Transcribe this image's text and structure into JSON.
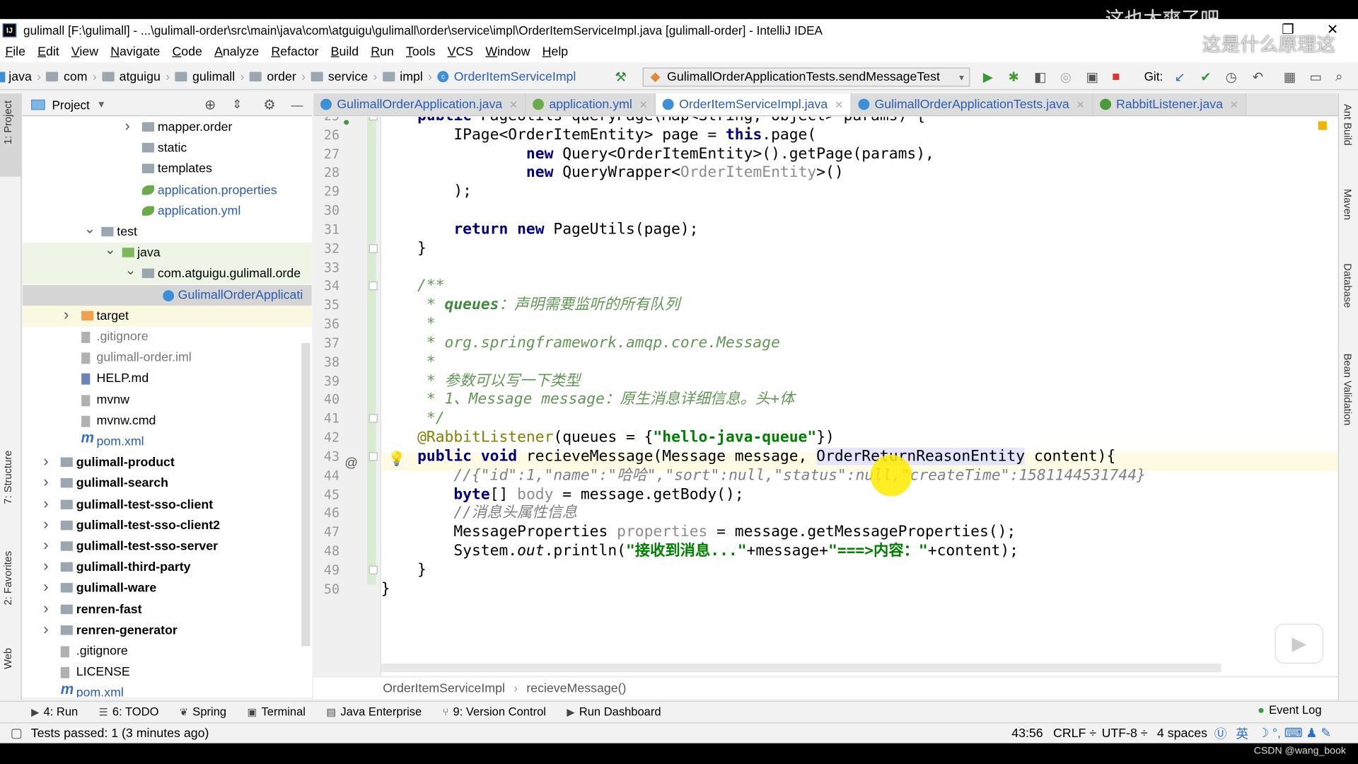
{
  "window": {
    "title": "gulimall [F:\\gulimall] - ...\\gulimall-order\\src\\main\\java\\com\\atguigu\\gulimall\\order\\service\\impl\\OrderItemServiceImpl.java [gulimall-order] - IntelliJ IDEA",
    "logo": "IJ"
  },
  "watermark": {
    "line1": "这也太爽了吧",
    "line2": "这是什么原理这"
  },
  "menu": [
    "File",
    "Edit",
    "View",
    "Navigate",
    "Code",
    "Analyze",
    "Refactor",
    "Build",
    "Run",
    "Tools",
    "VCS",
    "Window",
    "Help"
  ],
  "navbar": {
    "crumbs": [
      "java",
      "com",
      "atguigu",
      "gulimall",
      "order",
      "service",
      "impl"
    ],
    "class_crumb": "OrderItemServiceImpl",
    "run_config": "GulimallOrderApplicationTests.sendMessageTest",
    "git_label": "Git:"
  },
  "left_strip": [
    "1: Project",
    "7: Structure",
    "2: Favorites",
    "Web"
  ],
  "right_strip": [
    "Ant Build",
    "Maven",
    "Database",
    "Bean Validation"
  ],
  "project": {
    "title": "Project",
    "tree": [
      {
        "label": "mapper.order",
        "level": 5,
        "chevron": ">",
        "kind": "folder"
      },
      {
        "label": "static",
        "level": 5,
        "kind": "folder"
      },
      {
        "label": "templates",
        "level": 5,
        "kind": "folder"
      },
      {
        "label": "application.properties",
        "level": 5,
        "kind": "spring",
        "color": "#2a5db0"
      },
      {
        "label": "application.yml",
        "level": 5,
        "kind": "spring",
        "color": "#2a5db0"
      },
      {
        "label": "test",
        "level": 3,
        "chevron": "v",
        "kind": "folder"
      },
      {
        "label": "java",
        "level": 4,
        "chevron": "v",
        "kind": "greenfolder",
        "bg": "#eef5e6"
      },
      {
        "label": "com.atguigu.gulimall.orde",
        "level": 5,
        "chevron": "v",
        "kind": "folder",
        "bg": "#eef5e6"
      },
      {
        "label": "GulimallOrderApplicati",
        "level": 6,
        "kind": "class",
        "color": "#2a5db0",
        "bg": "#d5d5d5"
      },
      {
        "label": "target",
        "level": 2,
        "chevron": ">",
        "kind": "orangefolder",
        "bg": "#fbf8e0"
      },
      {
        "label": ".gitignore",
        "level": 2,
        "kind": "file",
        "color": "#777"
      },
      {
        "label": "gulimall-order.iml",
        "level": 2,
        "kind": "file",
        "color": "#777"
      },
      {
        "label": "HELP.md",
        "level": 2,
        "kind": "md"
      },
      {
        "label": "mvnw",
        "level": 2,
        "kind": "file"
      },
      {
        "label": "mvnw.cmd",
        "level": 2,
        "kind": "file"
      },
      {
        "label": "pom.xml",
        "level": 2,
        "kind": "maven",
        "color": "#2a5db0"
      },
      {
        "label": "gulimall-product",
        "level": 1,
        "chevron": ">",
        "kind": "module",
        "bold": true
      },
      {
        "label": "gulimall-search",
        "level": 1,
        "chevron": ">",
        "kind": "module",
        "bold": true
      },
      {
        "label": "gulimall-test-sso-client",
        "level": 1,
        "chevron": ">",
        "kind": "module",
        "bold": true
      },
      {
        "label": "gulimall-test-sso-client2",
        "level": 1,
        "chevron": ">",
        "kind": "module",
        "bold": true
      },
      {
        "label": "gulimall-test-sso-server",
        "level": 1,
        "chevron": ">",
        "kind": "module",
        "bold": true
      },
      {
        "label": "gulimall-third-party",
        "level": 1,
        "chevron": ">",
        "kind": "module",
        "bold": true
      },
      {
        "label": "gulimall-ware",
        "level": 1,
        "chevron": ">",
        "kind": "module",
        "bold": true
      },
      {
        "label": "renren-fast",
        "level": 1,
        "chevron": ">",
        "kind": "module",
        "bold": true
      },
      {
        "label": "renren-generator",
        "level": 1,
        "chevron": ">",
        "kind": "module",
        "bold": true
      },
      {
        "label": ".gitignore",
        "level": 1,
        "kind": "file"
      },
      {
        "label": "LICENSE",
        "level": 1,
        "kind": "file"
      },
      {
        "label": "pom.xml",
        "level": 1,
        "kind": "maven",
        "color": "#2a5db0"
      }
    ]
  },
  "tabs": [
    {
      "label": "GulimallOrderApplication.java",
      "icon": "class"
    },
    {
      "label": "application.yml",
      "icon": "spring"
    },
    {
      "label": "OrderItemServiceImpl.java",
      "icon": "class",
      "active": true
    },
    {
      "label": "GulimallOrderApplicationTests.java",
      "icon": "class"
    },
    {
      "label": "RabbitListener.java",
      "icon": "annotation"
    }
  ],
  "editor": {
    "first_line": 25,
    "current_line": 43,
    "lines": [
      [
        [
          "    "
        ],
        [
          "public ",
          "kw"
        ],
        [
          "PageUtils queryPage(Map<String, Object> params) {"
        ]
      ],
      [
        [
          "        IPage<OrderItemEntity> page = "
        ],
        [
          "this",
          "kw"
        ],
        [
          ".page("
        ]
      ],
      [
        [
          "                "
        ],
        [
          "new ",
          "kw"
        ],
        [
          "Query<OrderItemEntity>().getPage(params),"
        ]
      ],
      [
        [
          "                "
        ],
        [
          "new ",
          "kw"
        ],
        [
          "QueryWrapper<"
        ],
        [
          "OrderItemEntity",
          "gray"
        ],
        [
          ">()"
        ]
      ],
      [
        [
          "        );"
        ]
      ],
      [
        [
          ""
        ]
      ],
      [
        [
          "        "
        ],
        [
          "return new ",
          "kw"
        ],
        [
          "PageUtils(page);"
        ]
      ],
      [
        [
          "    }"
        ]
      ],
      [
        [
          ""
        ]
      ],
      [
        [
          "    /**",
          "doc"
        ]
      ],
      [
        [
          "     * ",
          "doc"
        ],
        [
          "queues",
          "docb"
        ],
        [
          "：声明需要监听的所有队列",
          "doc"
        ]
      ],
      [
        [
          "     *",
          "doc"
        ]
      ],
      [
        [
          "     * ",
          "doc"
        ],
        [
          "org.springframework.amqp.core.Message",
          "doc"
        ]
      ],
      [
        [
          "     *",
          "doc"
        ]
      ],
      [
        [
          "     * 参数可以写一下类型",
          "doc"
        ]
      ],
      [
        [
          "     * 1、Message message：原生消息详细信息。头+体",
          "doc"
        ]
      ],
      [
        [
          "     */",
          "doc"
        ]
      ],
      [
        [
          "    "
        ],
        [
          "@RabbitListener",
          "ann"
        ],
        [
          "(queues = {"
        ],
        [
          "\"hello-java-queue\"",
          "str"
        ],
        [
          "})"
        ]
      ],
      [
        [
          "    "
        ],
        [
          "public void ",
          "kw"
        ],
        [
          "recieveMessage(Message message, "
        ],
        [
          "OrderReturnReasonEntity",
          "hl"
        ],
        [
          " content){"
        ]
      ],
      [
        [
          "        //{\"id\":1,\"name\":\"哈哈\",\"sort\":null,\"status\":null,\"createTime\":1581144531744}",
          "cm"
        ]
      ],
      [
        [
          "        "
        ],
        [
          "byte",
          "kw"
        ],
        [
          "[] "
        ],
        [
          "body",
          "gray"
        ],
        [
          " = message.getBody();"
        ]
      ],
      [
        [
          "        //消息头属性信息",
          "cm"
        ]
      ],
      [
        [
          "        MessageProperties "
        ],
        [
          "properties",
          "gray"
        ],
        [
          " = message.getMessageProperties();"
        ]
      ],
      [
        [
          "        System."
        ],
        [
          "out",
          "it"
        ],
        [
          ".println("
        ],
        [
          "\"接收到消息...\"",
          "str"
        ],
        [
          "+message+"
        ],
        [
          "\"===>内容：\"",
          "str"
        ],
        [
          "+content);"
        ]
      ],
      [
        [
          "    }"
        ]
      ],
      [
        [
          "}"
        ]
      ]
    ]
  },
  "editor_breadcrumb": [
    "OrderItemServiceImpl",
    "recieveMessage()"
  ],
  "tool_windows": [
    {
      "label": "4: Run",
      "icon": "run-icon"
    },
    {
      "label": "6: TODO",
      "icon": "todo-icon"
    },
    {
      "label": "Spring",
      "icon": "spring-icon"
    },
    {
      "label": "Terminal",
      "icon": "terminal-icon"
    },
    {
      "label": "Java Enterprise",
      "icon": "java-enterprise-icon"
    },
    {
      "label": "9: Version Control",
      "icon": "vcs-icon"
    },
    {
      "label": "Run Dashboard",
      "icon": "run-dashboard-icon"
    }
  ],
  "event_log": "Event Log",
  "status": {
    "message": "Tests passed: 1 (3 minutes ago)",
    "position": "43:56",
    "line_sep": "CRLF ÷",
    "encoding": "UTF-8 ÷",
    "indent": "4 spaces",
    "ime": "英"
  },
  "footer": {
    "credit": "CSDN @wang_book"
  },
  "colors": {
    "keyword": "#000080",
    "string": "#008000",
    "doc_comment": "#629755",
    "annotation": "#808000",
    "accent": "#2a5db0"
  }
}
